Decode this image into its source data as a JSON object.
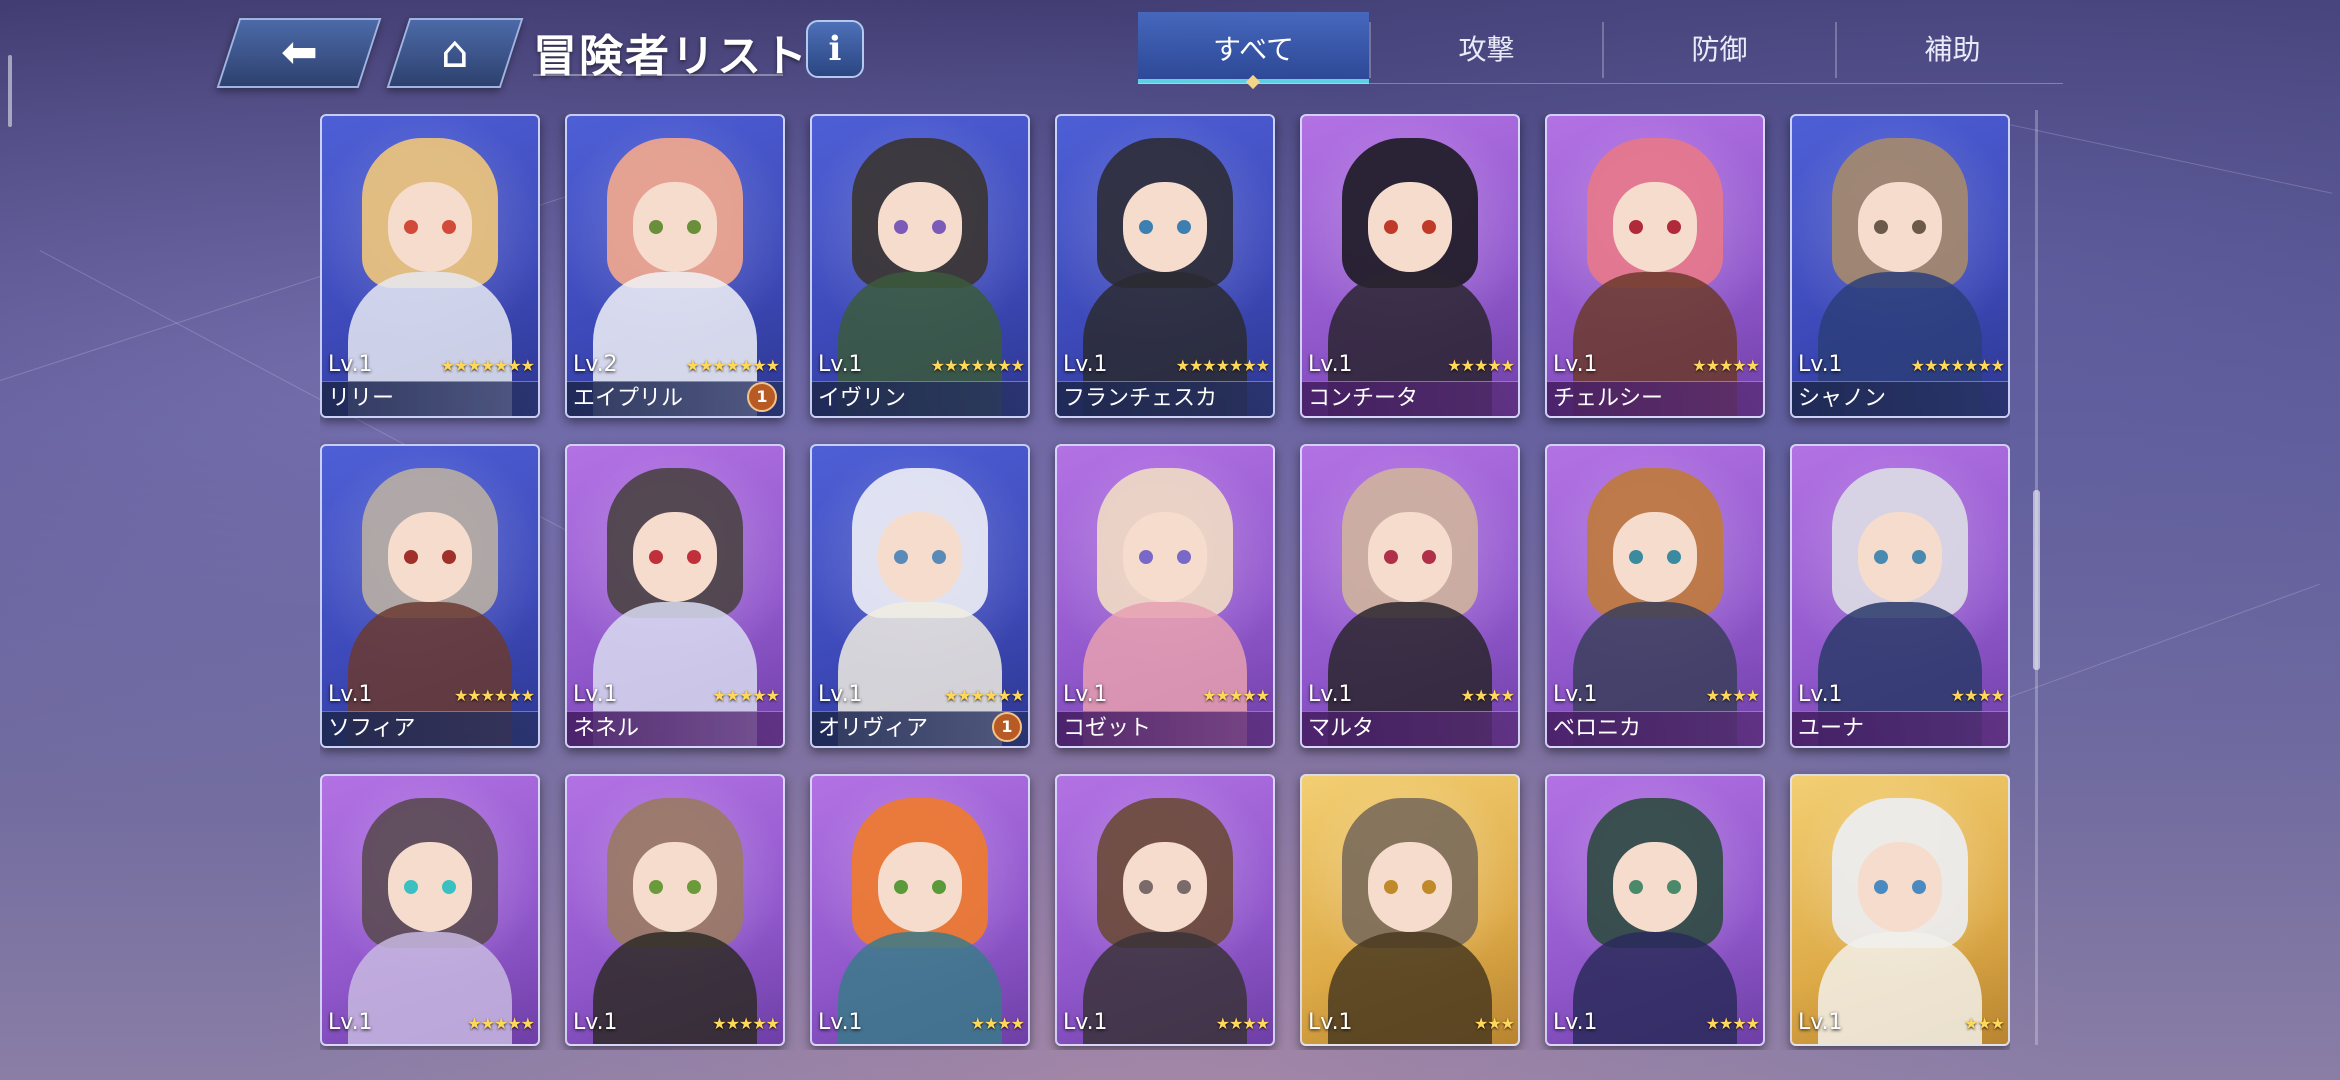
{
  "header": {
    "back_icon": "back-arrow-icon",
    "home_icon": "home-icon",
    "title": "冒険者リスト",
    "info_icon": "info-icon"
  },
  "tabs": [
    {
      "label": "すべて",
      "selected": true
    },
    {
      "label": "攻撃",
      "selected": false
    },
    {
      "label": "防御",
      "selected": false
    },
    {
      "label": "補助",
      "selected": false
    }
  ],
  "cards": [
    {
      "level": "Lv.1",
      "stars": "★★★★★★★",
      "name": "リリー",
      "bg": "blue",
      "hair": "#f0c77a",
      "eye": "#d24a3a",
      "outfit": "#e6e9f2"
    },
    {
      "level": "Lv.2",
      "stars": "★★★★★★★",
      "name": "エイプリル",
      "badge": "1",
      "bg": "blue",
      "hair": "#f4a98c",
      "eye": "#6a8f3a",
      "outfit": "#f1f2f7"
    },
    {
      "level": "Lv.1",
      "stars": "★★★★★★★",
      "name": "イヴリン",
      "bg": "blue",
      "hair": "#3a3430",
      "eye": "#7b5ab8",
      "outfit": "#3b5a3c"
    },
    {
      "level": "Lv.1",
      "stars": "★★★★★★★",
      "name": "フランチェスカ",
      "bg": "blue",
      "hair": "#2e2c36",
      "eye": "#3d7fb0",
      "outfit": "#2a2a30"
    },
    {
      "level": "Lv.1",
      "stars": "★★★★★",
      "name": "コンチータ",
      "bg": "purple",
      "hair": "#1c1a22",
      "eye": "#c03a2a",
      "outfit": "#2a2530"
    },
    {
      "level": "Lv.1",
      "stars": "★★★★★",
      "name": "チェルシー",
      "bg": "purple",
      "hair": "#e8788a",
      "eye": "#b02a3a",
      "outfit": "#6b3a2a"
    },
    {
      "level": "Lv.1",
      "stars": "★★★★★★★",
      "name": "シャノン",
      "bg": "blue",
      "hair": "#a68a6a",
      "eye": "#6b5a4a",
      "outfit": "#2b3e7a"
    },
    {
      "level": "Lv.1",
      "stars": "★★★★★★",
      "name": "ソフィア",
      "bg": "blue",
      "hair": "#b9aea3",
      "eye": "#a0302a",
      "outfit": "#6a3a30"
    },
    {
      "level": "Lv.1",
      "stars": "★★★★★",
      "name": "ネネル",
      "bg": "purple",
      "hair": "#4a4244",
      "eye": "#c0303a",
      "outfit": "#d8dcf0"
    },
    {
      "level": "Lv.1",
      "stars": "★★★★★★",
      "name": "オリヴィア",
      "badge": "1",
      "bg": "blue",
      "hair": "#eef0f6",
      "eye": "#5a8ab8",
      "outfit": "#f0ece0"
    },
    {
      "level": "Lv.1",
      "stars": "★★★★★",
      "name": "コゼット",
      "bg": "purple",
      "hair": "#f1dcc4",
      "eye": "#7a68c8",
      "outfit": "#e8a0b0"
    },
    {
      "level": "Lv.1",
      "stars": "★★★★",
      "name": "マルタ",
      "bg": "purple",
      "hair": "#cfb39c",
      "eye": "#b0304a",
      "outfit": "#2a262e"
    },
    {
      "level": "Lv.1",
      "stars": "★★★★",
      "name": "ベロニカ",
      "bg": "purple",
      "hair": "#c07a3a",
      "eye": "#3a8aa0",
      "outfit": "#3a3e5a"
    },
    {
      "level": "Lv.1",
      "stars": "★★★★",
      "name": "ユーナ",
      "bg": "purple",
      "hair": "#dcdde4",
      "eye": "#4a8ab0",
      "outfit": "#2a3a6a"
    },
    {
      "level": "Lv.1",
      "stars": "★★★★★",
      "bg": "purple",
      "hair": "#5a4a52",
      "eye": "#3ac0c0",
      "outfit": "#c8b8e0"
    },
    {
      "level": "Lv.1",
      "stars": "★★★★★",
      "bg": "purple",
      "hair": "#9a7a62",
      "eye": "#6a9a3a",
      "outfit": "#2e2a26"
    },
    {
      "level": "Lv.1",
      "stars": "★★★★",
      "bg": "purple",
      "hair": "#f07a2a",
      "eye": "#5a9a3a",
      "outfit": "#3a7a8a"
    },
    {
      "level": "Lv.1",
      "stars": "★★★★",
      "bg": "purple",
      "hair": "#6a4a36",
      "eye": "#7a6a6a",
      "outfit": "#3a3238"
    },
    {
      "level": "Lv.1",
      "stars": "★★★",
      "bg": "gold",
      "hair": "#7a6a5a",
      "eye": "#c08a2a",
      "outfit": "#4a3a20"
    },
    {
      "level": "Lv.1",
      "stars": "★★★★",
      "bg": "purple",
      "hair": "#2e4a40",
      "eye": "#4a8a6a",
      "outfit": "#2a2a5a"
    },
    {
      "level": "Lv.1",
      "stars": "★★★",
      "bg": "gold",
      "hair": "#eceef4",
      "eye": "#4a8ac0",
      "outfit": "#f2f0ea"
    }
  ]
}
